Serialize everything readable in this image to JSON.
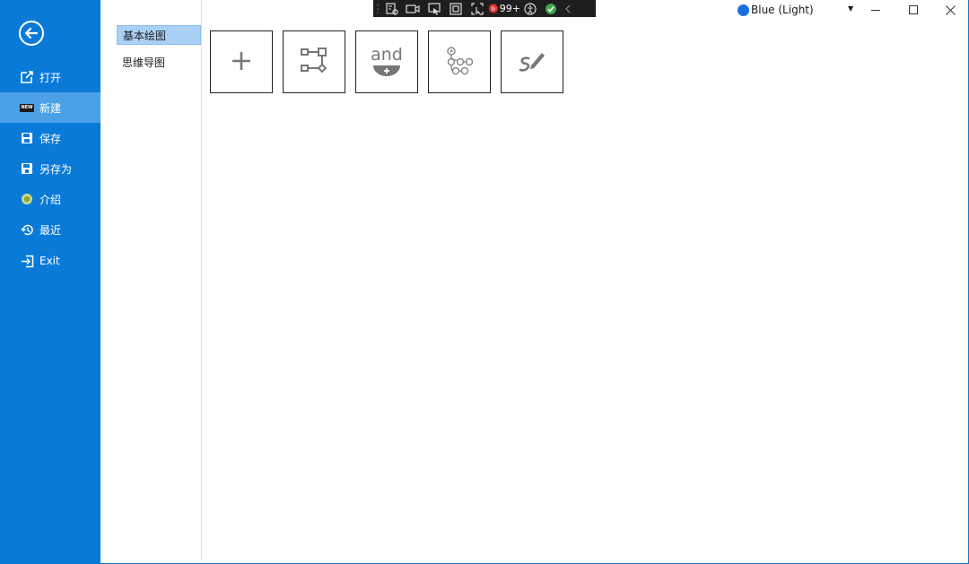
{
  "sidebar": {
    "items": [
      {
        "label": "打开",
        "icon": "open-external-icon"
      },
      {
        "label": "新建",
        "icon": "new-badge-icon",
        "badge": "NEW"
      },
      {
        "label": "保存",
        "icon": "save-icon"
      },
      {
        "label": "另存为",
        "icon": "save-as-icon"
      },
      {
        "label": "介绍",
        "icon": "info-globe-icon"
      },
      {
        "label": "最近",
        "icon": "recent-history-icon"
      },
      {
        "label": "Exit",
        "icon": "exit-icon"
      }
    ],
    "active_index": 1
  },
  "categories": {
    "items": [
      {
        "label": "基本绘图"
      },
      {
        "label": "思维导图"
      }
    ],
    "active_index": 0
  },
  "templates": [
    {
      "icon": "plus-icon"
    },
    {
      "icon": "flowchart-icon"
    },
    {
      "icon": "logic-and-gate-icon",
      "text": "and"
    },
    {
      "icon": "workflow-tree-icon"
    },
    {
      "icon": "freehand-pen-icon"
    }
  ],
  "debug_toolbar": {
    "counter": "99+"
  },
  "theme": {
    "label": "Blue (Light)",
    "dot_color": "#1a6fe0"
  },
  "colors": {
    "sidebar": "#0a7ad8",
    "sidebar_active": "#4aa1e6",
    "category_active": "#a9d1f5"
  }
}
